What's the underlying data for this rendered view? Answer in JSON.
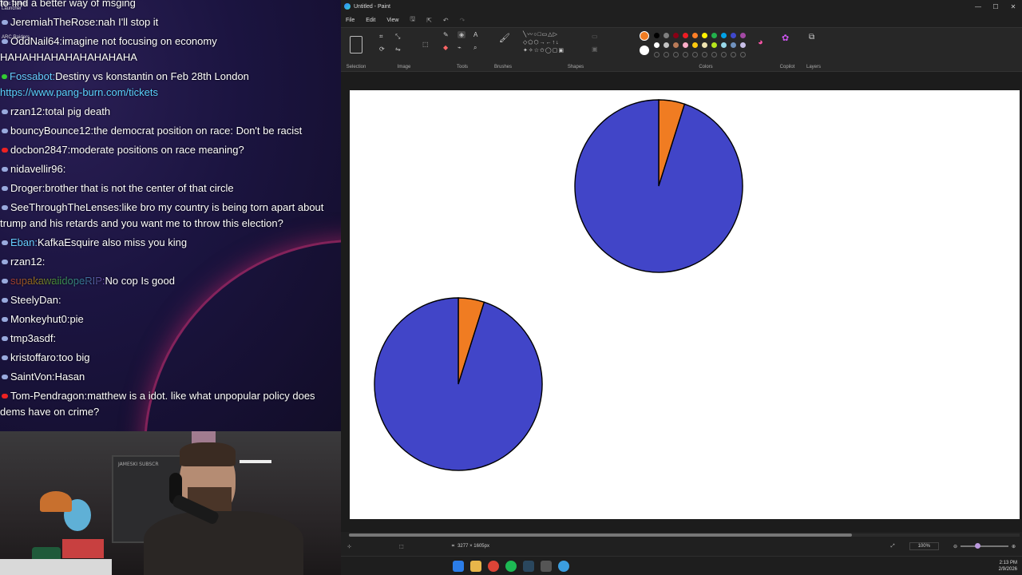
{
  "chat": {
    "lines": [
      {
        "badge": "",
        "user": "",
        "text": "to find a better way of msging"
      },
      {
        "badge": "blue",
        "user": "JeremiahTheRose:",
        "text": "nah I'll stop it"
      },
      {
        "badge": "blue",
        "user": "OddNail64:",
        "text": "imagine not focusing on economy HAHAHHAHAHAHAHAHAHA"
      },
      {
        "badge": "green",
        "user": "Fossabot:",
        "text": "Destiny vs konstantin on Feb 28th London",
        "link": "https://www.pang-burn.com/tickets"
      },
      {
        "badge": "blue",
        "user": "rzan12:",
        "text": "total pig death"
      },
      {
        "badge": "blue",
        "user": "bouncyBounce12:",
        "text": "the democrat position on race: Don't be racist"
      },
      {
        "badge": "red",
        "user": "docbon2847:",
        "text": "moderate positions on race meaning?"
      },
      {
        "badge": "blue",
        "user": "nidavellir96:",
        "text": ""
      },
      {
        "badge": "blue",
        "user": "Droger:",
        "text": "brother that is not the center of that circle"
      },
      {
        "badge": "blue",
        "user": "SeeThroughTheLenses:",
        "text": "like bro my country is being torn apart about trump and his retards and you want me to throw this election?"
      },
      {
        "badge": "blue",
        "user": "Eban:",
        "text": "KafkaEsquire also  miss you king"
      },
      {
        "badge": "blue",
        "user": "rzan12:",
        "text": ""
      },
      {
        "badge": "blue",
        "user": "supakawaiidopeRIP:",
        "text": "No cop  Is good"
      },
      {
        "badge": "blue",
        "user": "SteelyDan:",
        "text": ""
      },
      {
        "badge": "blue",
        "user": "Monkeyhut0:",
        "text": "pie"
      },
      {
        "badge": "blue",
        "user": "tmp3asdf:",
        "text": ""
      },
      {
        "badge": "blue",
        "user": "kristoffaro:",
        "text": "too big"
      },
      {
        "badge": "blue",
        "user": "SaintVon:",
        "text": "Hasan"
      },
      {
        "badge": "red",
        "user": "Tom-Pendragon:",
        "text": "matthew is a idot. like what unpopular policy does dems have on crime?"
      }
    ],
    "desktop_icons": [
      "Epic Games Launcher",
      "ARC Raiders"
    ]
  },
  "webcam": {
    "poster_text": "JAMESKI SUBSCR"
  },
  "paint": {
    "title": "Untitled - Paint",
    "window_controls": [
      "—",
      "☐",
      "✕"
    ],
    "menu": [
      "File",
      "Edit",
      "View"
    ],
    "ribbon_groups": [
      "Selection",
      "Image",
      "Tools",
      "Brushes",
      "Shapes",
      "Colors",
      "Copilot",
      "Layers"
    ],
    "status": {
      "canvas_size": "3277 × 1605px",
      "zoom": "100%"
    },
    "colors": {
      "active": "#f07c22",
      "palette_row1": [
        "#000000",
        "#7f7f7f",
        "#880015",
        "#ed1c24",
        "#ff7f27",
        "#fff200",
        "#22b14c",
        "#00a2e8",
        "#3f48cc",
        "#a349a4"
      ],
      "palette_row2": [
        "#ffffff",
        "#c3c3c3",
        "#b97a57",
        "#ffaec9",
        "#ffc90e",
        "#efe4b0",
        "#b5e61d",
        "#99d9ea",
        "#7092be",
        "#c8bfe7"
      ]
    }
  },
  "chart_data": [
    {
      "type": "pie",
      "slices": [
        {
          "label": "",
          "value": 0.95,
          "color": "#4145c8"
        },
        {
          "label": "",
          "value": 0.05,
          "color": "#f07c22"
        }
      ]
    },
    {
      "type": "pie",
      "slices": [
        {
          "label": "",
          "value": 0.95,
          "color": "#4145c8"
        },
        {
          "label": "",
          "value": 0.05,
          "color": "#f07c22"
        }
      ]
    }
  ],
  "taskbar": {
    "time": "2:13 PM",
    "date": "2/9/2026"
  }
}
